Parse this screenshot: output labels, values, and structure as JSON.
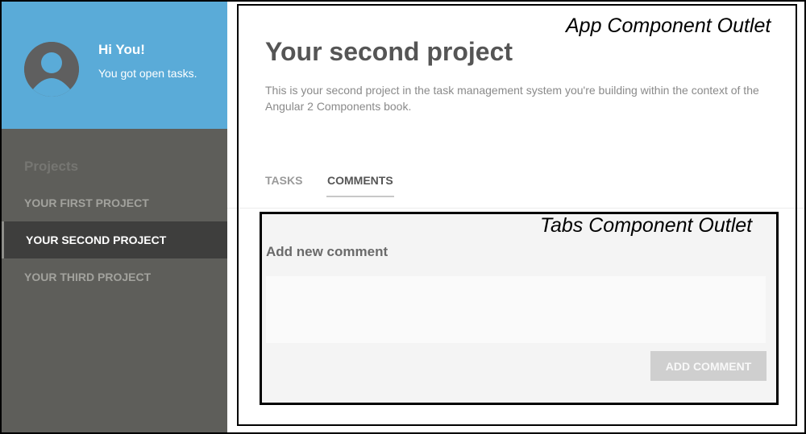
{
  "sidebar": {
    "profile": {
      "greeting": "Hi You!",
      "message": "You got open tasks."
    },
    "projects_heading": "Projects",
    "projects": [
      {
        "label": "YOUR FIRST PROJECT",
        "active": false
      },
      {
        "label": "YOUR SECOND PROJECT",
        "active": true
      },
      {
        "label": "YOUR THIRD PROJECT",
        "active": false
      }
    ]
  },
  "main": {
    "title": "Your second project",
    "description": "This is your second project in the task management system you're building within the context of the Angular 2 Components book.",
    "tabs": [
      {
        "label": "TASKS",
        "active": false
      },
      {
        "label": "COMMENTS",
        "active": true
      }
    ],
    "comments": {
      "heading": "Add new comment",
      "input_value": "",
      "add_button": "ADD COMMENT"
    }
  },
  "annotations": {
    "app_outlet": "App Component Outlet",
    "tabs_outlet": "Tabs Component Outlet"
  },
  "colors": {
    "profile_bg": "#5aabd8",
    "sidebar_bg": "#5e5e5a",
    "active_item_bg": "#3e3e3d"
  },
  "icons": {
    "avatar": "user-silhouette-icon"
  }
}
